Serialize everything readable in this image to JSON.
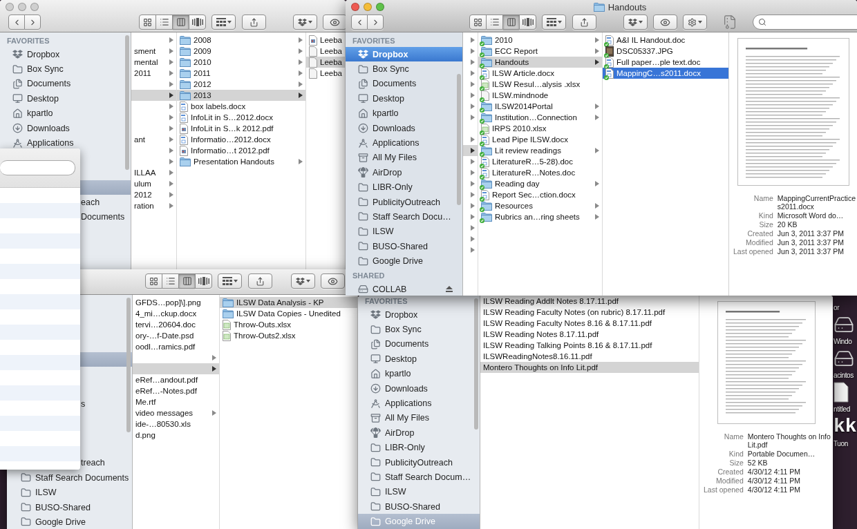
{
  "windows": [
    {
      "active": false,
      "toolbar": {
        "tools": [
          {
            "kind": "nav"
          },
          {
            "kind": "views",
            "options": [
              {
                "kind": "icons",
                "selected": false
              },
              {
                "kind": "list",
                "selected": false
              },
              {
                "kind": "columns",
                "selected": true
              },
              {
                "kind": "coverflow",
                "selected": false
              }
            ]
          },
          {
            "kind": "arrange"
          },
          {
            "kind": "share"
          },
          {
            "kind": "dropbox"
          },
          {
            "kind": "eye"
          }
        ]
      },
      "sidebar": {
        "sections": [
          {
            "heading": "FAVORITES",
            "items": [
              {
                "kind": "dropbox",
                "label": "Dropbox",
                "selected": false
              },
              {
                "kind": "folder",
                "label": "Box Sync",
                "selected": false
              },
              {
                "kind": "documents",
                "label": "Documents",
                "selected": false
              },
              {
                "kind": "desktop",
                "label": "Desktop",
                "selected": false
              },
              {
                "kind": "home",
                "label": "kpartlo",
                "selected": false
              },
              {
                "kind": "downloads",
                "label": "Downloads",
                "selected": false
              },
              {
                "kind": "applications",
                "label": "Applications",
                "selected": false
              },
              {
                "kind": "covered",
                "selected": false
              },
              {
                "kind": "covered",
                "selected": false
              },
              {
                "kind": "covered",
                "selected": true
              },
              {
                "kind": "clipped",
                "label": "each",
                "selected": false
              },
              {
                "kind": "clipped",
                "label": "Documents",
                "selected": false
              }
            ]
          }
        ]
      },
      "columns": [
        {
          "items": [
            {
              "kind": "text",
              "arrow": true,
              "selected": false
            },
            {
              "kind": "text",
              "label": "sment",
              "arrow": true,
              "selected": false
            },
            {
              "kind": "text",
              "label": "mental",
              "arrow": true,
              "selected": false
            },
            {
              "kind": "text",
              "label": "2011",
              "arrow": true,
              "selected": false
            },
            {
              "kind": "text",
              "arrow": true,
              "selected": false
            },
            {
              "kind": "text",
              "arrow": true,
              "selected": true
            },
            {
              "kind": "text",
              "arrow": true,
              "selected": false
            },
            {
              "kind": "text",
              "arrow": true,
              "selected": false
            },
            {
              "kind": "text",
              "arrow": true,
              "selected": false
            },
            {
              "kind": "text",
              "label": "ant",
              "arrow": true,
              "selected": false
            },
            {
              "kind": "text",
              "arrow": true,
              "selected": false
            },
            {
              "kind": "text",
              "arrow": true,
              "selected": false
            },
            {
              "kind": "text",
              "label": "ILLAA",
              "arrow": true,
              "selected": false
            },
            {
              "kind": "text",
              "label": "ulum",
              "arrow": true,
              "selected": false
            },
            {
              "kind": "text",
              "label": "2012",
              "arrow": true,
              "selected": false
            },
            {
              "kind": "text",
              "label": "ration",
              "arrow": true,
              "selected": false
            }
          ]
        },
        {
          "items": [
            {
              "kind": "folder",
              "label": "2008",
              "arrow": true,
              "selected": false
            },
            {
              "kind": "folder",
              "label": "2009",
              "arrow": true,
              "selected": false
            },
            {
              "kind": "folder",
              "label": "2010",
              "arrow": true,
              "selected": false
            },
            {
              "kind": "folder",
              "label": "2011",
              "arrow": true,
              "selected": false
            },
            {
              "kind": "folder",
              "label": "2012",
              "arrow": true,
              "selected": false
            },
            {
              "kind": "folder",
              "label": "2013",
              "arrow": true,
              "selected": true
            },
            {
              "kind": "doc",
              "label": "box labels.docx",
              "arrow": false,
              "selected": false
            },
            {
              "kind": "doc",
              "label": "InfoLit in S…2012.docx",
              "arrow": false,
              "selected": false
            },
            {
              "kind": "pdf",
              "label": "InfoLit in S…k 2012.pdf",
              "arrow": false,
              "selected": false
            },
            {
              "kind": "doc",
              "label": "Informatio…2012.docx",
              "arrow": false,
              "selected": false
            },
            {
              "kind": "pdf",
              "label": "Informatio…t 2012.pdf",
              "arrow": false,
              "selected": false
            },
            {
              "kind": "folder",
              "label": "Presentation Handouts",
              "arrow": true,
              "selected": false
            }
          ]
        },
        {
          "items": [
            {
              "kind": "pdf",
              "label": "Leeba",
              "arrow": false,
              "selected": false
            },
            {
              "kind": "file",
              "label": "Leeba",
              "arrow": false,
              "selected": false
            },
            {
              "kind": "file",
              "label": "Leeba",
              "arrow": false,
              "selected": true
            },
            {
              "kind": "file",
              "label": "Leeba",
              "arrow": false,
              "selected": false
            }
          ]
        }
      ]
    },
    {
      "active": true,
      "title": "Handouts",
      "toolbar": {
        "tools": [
          {
            "kind": "nav"
          },
          {
            "kind": "views",
            "options": [
              {
                "kind": "icons",
                "selected": false
              },
              {
                "kind": "list",
                "selected": false
              },
              {
                "kind": "columns",
                "selected": true
              },
              {
                "kind": "coverflow",
                "selected": false
              }
            ]
          },
          {
            "kind": "arrange"
          },
          {
            "kind": "share"
          },
          {
            "kind": "dropbox"
          },
          {
            "kind": "eye"
          },
          {
            "kind": "gear"
          },
          {
            "kind": "zip"
          },
          {
            "kind": "search"
          }
        ]
      },
      "sidebar": {
        "sections": [
          {
            "heading": "FAVORITES",
            "items": [
              {
                "kind": "dropbox",
                "label": "Dropbox",
                "selected": true
              },
              {
                "kind": "folder",
                "label": "Box Sync",
                "selected": false
              },
              {
                "kind": "documents",
                "label": "Documents",
                "selected": false
              },
              {
                "kind": "desktop",
                "label": "Desktop",
                "selected": false
              },
              {
                "kind": "home",
                "label": "kpartlo",
                "selected": false
              },
              {
                "kind": "downloads",
                "label": "Downloads",
                "selected": false
              },
              {
                "kind": "applications",
                "label": "Applications",
                "selected": false
              },
              {
                "kind": "allfiles",
                "label": "All My Files",
                "selected": false
              },
              {
                "kind": "airdrop",
                "label": "AirDrop",
                "selected": false
              },
              {
                "kind": "folder",
                "label": "LIBR-Only",
                "selected": false
              },
              {
                "kind": "folder",
                "label": "PublicityOutreach",
                "selected": false
              },
              {
                "kind": "folder",
                "label": "Staff Search Docu…",
                "selected": false
              },
              {
                "kind": "folder",
                "label": "ILSW",
                "selected": false
              },
              {
                "kind": "folder",
                "label": "BUSO-Shared",
                "selected": false
              },
              {
                "kind": "folder",
                "label": "Google Drive",
                "selected": false
              }
            ]
          },
          {
            "heading": "SHARED",
            "items": [
              {
                "kind": "server",
                "label": "COLLAB",
                "ejectable": true,
                "selected": false
              }
            ]
          }
        ]
      },
      "columns": [
        {
          "focused": false,
          "items": [
            {
              "kind": "text",
              "arrow": true,
              "selected": false
            },
            {
              "kind": "text",
              "arrow": true,
              "selected": false
            },
            {
              "kind": "text",
              "arrow": true,
              "selected": false
            },
            {
              "kind": "text",
              "arrow": true,
              "selected": false
            },
            {
              "kind": "text",
              "arrow": true,
              "selected": false
            },
            {
              "kind": "text",
              "arrow": true,
              "selected": false
            },
            {
              "kind": "text",
              "arrow": true,
              "selected": false
            },
            {
              "kind": "text",
              "arrow": true,
              "selected": false
            },
            {
              "kind": "text",
              "arrow": false,
              "selected": false
            },
            {
              "kind": "text",
              "arrow": true,
              "selected": false
            },
            {
              "kind": "text",
              "arrow": true,
              "selected": true
            },
            {
              "kind": "text",
              "arrow": true,
              "selected": false
            },
            {
              "kind": "text",
              "arrow": true,
              "selected": false
            },
            {
              "kind": "text",
              "arrow": true,
              "selected": false
            },
            {
              "kind": "text",
              "arrow": true,
              "selected": false
            },
            {
              "kind": "text",
              "arrow": true,
              "selected": false
            },
            {
              "kind": "text",
              "arrow": true,
              "selected": false
            },
            {
              "kind": "text",
              "arrow": true,
              "selected": false
            },
            {
              "kind": "text",
              "arrow": true,
              "selected": false
            },
            {
              "kind": "text",
              "arrow": true,
              "selected": false
            }
          ]
        },
        {
          "focused": false,
          "items": [
            {
              "kind": "folder",
              "label": "2010",
              "arrow": true,
              "synced": true,
              "selected": false
            },
            {
              "kind": "folder",
              "label": "ECC Report",
              "arrow": true,
              "synced": true,
              "selected": false
            },
            {
              "kind": "folder",
              "label": "Handouts",
              "arrow": true,
              "synced": true,
              "selected": true
            },
            {
              "kind": "doc",
              "label": "ILSW Article.docx",
              "arrow": false,
              "synced": true,
              "selected": false
            },
            {
              "kind": "sheet",
              "label": "ILSW Resul…alysis .xlsx",
              "arrow": false,
              "synced": true,
              "selected": false
            },
            {
              "kind": "file",
              "label": "ILSW.mindnode",
              "arrow": false,
              "synced": true,
              "selected": false
            },
            {
              "kind": "folder",
              "label": "ILSW2014Portal",
              "arrow": true,
              "synced": true,
              "selected": false
            },
            {
              "kind": "folder",
              "label": "Institution…Connection",
              "arrow": true,
              "synced": true,
              "selected": false
            },
            {
              "kind": "sheet",
              "label": "IRPS 2010.xlsx",
              "arrow": false,
              "synced": true,
              "selected": false
            },
            {
              "kind": "doc",
              "label": "Lead Pipe ILSW.docx",
              "arrow": false,
              "synced": true,
              "selected": false
            },
            {
              "kind": "folder",
              "label": "Lit review readings",
              "arrow": true,
              "synced": true,
              "selected": false
            },
            {
              "kind": "doc",
              "label": "LiteratureR…5-28).doc",
              "arrow": false,
              "synced": true,
              "selected": false
            },
            {
              "kind": "doc",
              "label": "LiteratureR…Notes.doc",
              "arrow": false,
              "synced": true,
              "selected": false
            },
            {
              "kind": "folder",
              "label": "Reading day",
              "arrow": true,
              "synced": true,
              "selected": false
            },
            {
              "kind": "doc",
              "label": "Report Sec…ction.docx",
              "arrow": false,
              "synced": true,
              "selected": false
            },
            {
              "kind": "folder",
              "label": "Resources",
              "arrow": true,
              "synced": true,
              "selected": false
            },
            {
              "kind": "folder",
              "label": "Rubrics an…ring sheets",
              "arrow": true,
              "synced": true,
              "selected": false
            }
          ]
        },
        {
          "focused": true,
          "items": [
            {
              "kind": "doc",
              "label": "A&I IL Handout.doc",
              "arrow": false,
              "synced": true,
              "selected": false
            },
            {
              "kind": "image",
              "label": "DSC05337.JPG",
              "arrow": false,
              "synced": true,
              "selected": false
            },
            {
              "kind": "doc",
              "label": "Full paper…ple text.doc",
              "arrow": false,
              "synced": true,
              "selected": false
            },
            {
              "kind": "doc",
              "label": "MappingC…s2011.docx",
              "arrow": false,
              "synced": true,
              "selected": true
            }
          ]
        }
      ],
      "preview": {
        "info": [
          {
            "key": "Name",
            "value": "MappingCurrentPractices2011.docx"
          },
          {
            "key": "Kind",
            "value": "Microsoft Word do…"
          },
          {
            "key": "Size",
            "value": "20 KB"
          },
          {
            "key": "Created",
            "value": "Jun 3, 2011 3:37 PM"
          },
          {
            "key": "Modified",
            "value": "Jun 3, 2011 3:37 PM"
          },
          {
            "key": "Last opened",
            "value": "Jun 3, 2011 3:37 PM"
          }
        ]
      }
    },
    {
      "active": false,
      "toolbar": {
        "tools": [
          {
            "kind": "views",
            "options": [
              {
                "kind": "icons",
                "selected": false
              },
              {
                "kind": "list",
                "selected": false
              },
              {
                "kind": "columns",
                "selected": true
              },
              {
                "kind": "coverflow",
                "selected": false
              }
            ]
          },
          {
            "kind": "arrange"
          },
          {
            "kind": "share"
          },
          {
            "kind": "dropbox"
          },
          {
            "kind": "eye"
          }
        ]
      },
      "sidebar": {
        "sections": [
          {
            "items": [
              {
                "kind": "covered",
                "selected": true
              },
              {
                "kind": "covered",
                "selected": false
              },
              {
                "kind": "covered",
                "selected": false
              },
              {
                "kind": "clipped",
                "label": "s",
                "selected": false
              },
              {
                "kind": "covered",
                "selected": false
              },
              {
                "kind": "covered",
                "selected": false
              },
              {
                "kind": "covered",
                "selected": false
              },
              {
                "kind": "clipped",
                "label": "treach",
                "selected": false
              },
              {
                "kind": "folder",
                "label": "Staff Search Documents",
                "selected": false
              },
              {
                "kind": "folder",
                "label": "ILSW",
                "selected": false
              },
              {
                "kind": "folder",
                "label": "BUSO-Shared",
                "selected": false
              },
              {
                "kind": "folder",
                "label": "Google Drive",
                "selected": false
              }
            ]
          }
        ]
      },
      "columns": [
        {
          "items": [
            {
              "kind": "text",
              "label": "GFDS…pop]\\].png",
              "arrow": false,
              "selected": false
            },
            {
              "kind": "text",
              "label": "4_mi…ckup.docx",
              "arrow": false,
              "selected": false
            },
            {
              "kind": "text",
              "label": "tervi…20604.doc",
              "arrow": false,
              "selected": false
            },
            {
              "kind": "text",
              "label": "ory-…f-Date.psd",
              "arrow": false,
              "selected": false
            },
            {
              "kind": "text",
              "label": "oodl…ramics.pdf",
              "arrow": false,
              "selected": false
            },
            {
              "kind": "text",
              "arrow": true,
              "selected": false
            },
            {
              "kind": "text",
              "arrow": true,
              "selected": true
            },
            {
              "kind": "text",
              "label": "eRef…andout.pdf",
              "arrow": false,
              "selected": false
            },
            {
              "kind": "text",
              "label": "eRef…-Notes.pdf",
              "arrow": false,
              "selected": false
            },
            {
              "kind": "text",
              "label": "Me.rtf",
              "arrow": false,
              "selected": false
            },
            {
              "kind": "text",
              "label": "video messages",
              "arrow": true,
              "selected": false
            },
            {
              "kind": "text",
              "label": "ide-…80530.xls",
              "arrow": false,
              "selected": false
            },
            {
              "kind": "text",
              "label": "d.png",
              "arrow": false,
              "selected": false
            }
          ]
        },
        {
          "items": [
            {
              "kind": "folder",
              "label": "ILSW Data Analysis - KP",
              "arrow": false,
              "selected": true
            },
            {
              "kind": "folder",
              "label": "ILSW Data Copies - Unedited",
              "arrow": false,
              "selected": false
            },
            {
              "kind": "sheet",
              "label": "Throw-Outs.xlsx",
              "arrow": false,
              "selected": false
            },
            {
              "kind": "sheet",
              "label": "Throw-Outs2.xlsx",
              "arrow": false,
              "selected": false
            }
          ]
        }
      ]
    },
    {
      "active": false,
      "sidebar": {
        "sections": [
          {
            "heading": "FAVORITES",
            "items": [
              {
                "kind": "dropbox",
                "label": "Dropbox",
                "selected": false
              },
              {
                "kind": "folder",
                "label": "Box Sync",
                "selected": false
              },
              {
                "kind": "documents",
                "label": "Documents",
                "selected": false
              },
              {
                "kind": "desktop",
                "label": "Desktop",
                "selected": false
              },
              {
                "kind": "home",
                "label": "kpartlo",
                "selected": false
              },
              {
                "kind": "downloads",
                "label": "Downloads",
                "selected": false
              },
              {
                "kind": "applications",
                "label": "Applications",
                "selected": false
              },
              {
                "kind": "allfiles",
                "label": "All My Files",
                "selected": false
              },
              {
                "kind": "airdrop",
                "label": "AirDrop",
                "selected": false
              },
              {
                "kind": "folder",
                "label": "LIBR-Only",
                "selected": false
              },
              {
                "kind": "folder",
                "label": "PublicityOutreach",
                "selected": false
              },
              {
                "kind": "folder",
                "label": "Staff Search Docum…",
                "selected": false
              },
              {
                "kind": "folder",
                "label": "ILSW",
                "selected": false
              },
              {
                "kind": "folder",
                "label": "BUSO-Shared",
                "selected": false
              },
              {
                "kind": "folder",
                "label": "Google Drive",
                "selected": true
              }
            ]
          }
        ]
      },
      "columns": [
        {
          "items": [
            {
              "kind": "text",
              "label": "ILSW Reading Addlt Notes 8.17.11.pdf",
              "arrow": false,
              "selected": false
            },
            {
              "kind": "text",
              "label": "ILSW Reading Faculty Notes (on rubric) 8.17.11.pdf",
              "arrow": false,
              "selected": false
            },
            {
              "kind": "text",
              "label": "ILSW Reading Faculty Notes 8.16 & 8.17.11.pdf",
              "arrow": false,
              "selected": false
            },
            {
              "kind": "text",
              "label": "ILSW Reading Notes 8.17.11.pdf",
              "arrow": false,
              "selected": false
            },
            {
              "kind": "text",
              "label": "ILSW Reading Talking Points 8.16 & 8.17.11.pdf",
              "arrow": false,
              "selected": false
            },
            {
              "kind": "text",
              "label": "ILSWReadingNotes8.16.11.pdf",
              "arrow": false,
              "selected": false
            },
            {
              "kind": "text",
              "label": "Montero Thoughts on Info Lit.pdf",
              "arrow": false,
              "selected": true
            }
          ]
        }
      ],
      "preview": {
        "info": [
          {
            "key": "Name",
            "value": "Montero Thoughts on Info Lit.pdf"
          },
          {
            "key": "Kind",
            "value": "Portable Documen…"
          },
          {
            "key": "Size",
            "value": "52 KB"
          },
          {
            "key": "Created",
            "value": "4/30/12 4:11 PM"
          },
          {
            "key": "Modified",
            "value": "4/30/12 4:11 PM"
          },
          {
            "key": "Last opened",
            "value": "4/30/12 4:11 PM"
          }
        ]
      }
    }
  ],
  "desktop": {
    "items": [
      {
        "kind": "label",
        "text": "or"
      },
      {
        "kind": "drive",
        "text": "Windo"
      },
      {
        "kind": "drive",
        "text": "acintos"
      },
      {
        "kind": "file",
        "text": "ntitled"
      },
      {
        "kind": "big",
        "text": "kk"
      },
      {
        "kind": "label",
        "text": "Tuon"
      }
    ]
  }
}
